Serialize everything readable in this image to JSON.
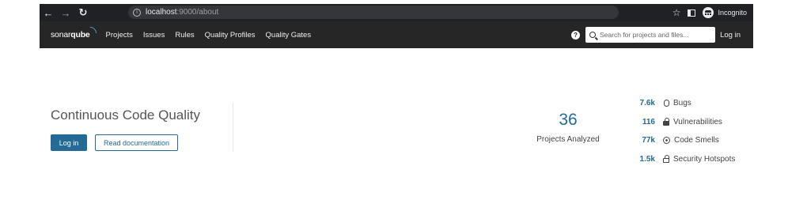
{
  "browser": {
    "url_host": "localhost",
    "url_path": ":9000/about",
    "profile_label": "Incognito",
    "icons": [
      "back-icon",
      "forward-icon",
      "reload-icon",
      "info-icon",
      "star-icon",
      "side-panel-icon",
      "incognito-icon"
    ]
  },
  "nav": {
    "logo_main": "sonar",
    "logo_bold": "qube",
    "links": [
      "Projects",
      "Issues",
      "Rules",
      "Quality Profiles",
      "Quality Gates"
    ],
    "search_placeholder": "Search for projects and files...",
    "login_label": "Log in"
  },
  "hero": {
    "title": "Continuous Code Quality",
    "login_button": "Log in",
    "docs_button": "Read documentation"
  },
  "stats": {
    "projects_count": "36",
    "projects_label": "Projects Analyzed",
    "metrics": [
      {
        "value": "7.6k",
        "label": "Bugs",
        "icon": "bug-icon"
      },
      {
        "value": "116",
        "label": "Vulnerabilities",
        "icon": "lock-icon"
      },
      {
        "value": "77k",
        "label": "Code Smells",
        "icon": "code-smell-icon"
      },
      {
        "value": "1.5k",
        "label": "Security Hotspots",
        "icon": "hotspot-icon"
      }
    ]
  },
  "colors": {
    "accent": "#236a97",
    "nav_bg": "#262626",
    "browser_bg": "#202124"
  }
}
